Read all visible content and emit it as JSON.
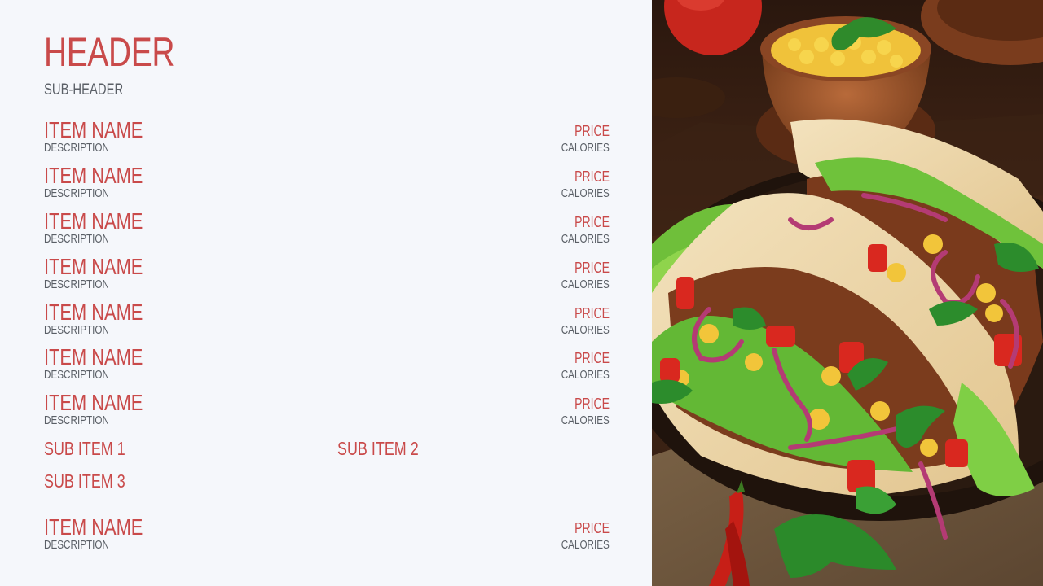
{
  "menu": {
    "header": "HEADER",
    "subheader": "SUB-HEADER",
    "items": [
      {
        "name": "ITEM NAME",
        "description": "DESCRIPTION",
        "price": "PRICE",
        "calories": "CALORIES"
      },
      {
        "name": "ITEM NAME",
        "description": "DESCRIPTION",
        "price": "PRICE",
        "calories": "CALORIES"
      },
      {
        "name": "ITEM NAME",
        "description": "DESCRIPTION",
        "price": "PRICE",
        "calories": "CALORIES"
      },
      {
        "name": "ITEM NAME",
        "description": "DESCRIPTION",
        "price": "PRICE",
        "calories": "CALORIES"
      },
      {
        "name": "ITEM NAME",
        "description": "DESCRIPTION",
        "price": "PRICE",
        "calories": "CALORIES"
      },
      {
        "name": "ITEM NAME",
        "description": "DESCRIPTION",
        "price": "PRICE",
        "calories": "CALORIES"
      },
      {
        "name": "ITEM NAME",
        "description": "DESCRIPTION",
        "price": "PRICE",
        "calories": "CALORIES"
      }
    ],
    "sub_items": [
      "SUB ITEM 1",
      "SUB ITEM 2",
      "SUB ITEM 3"
    ],
    "footer_item": {
      "name": "ITEM NAME",
      "description": "DESCRIPTION",
      "price": "PRICE",
      "calories": "CALORIES"
    }
  },
  "colors": {
    "accent": "#c94a4a",
    "muted_text": "#5a5f66",
    "background": "#f5f7fb"
  },
  "photo": {
    "icon": "tacos-photo"
  }
}
